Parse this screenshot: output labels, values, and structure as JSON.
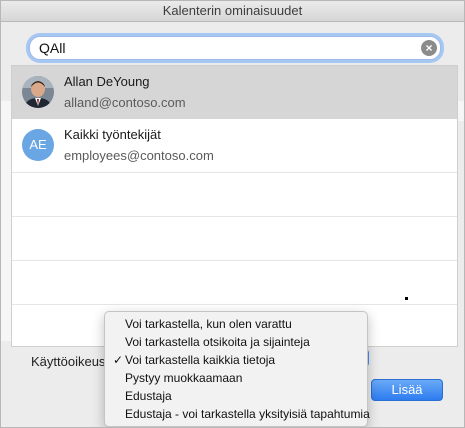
{
  "window": {
    "title": "Kalenterin ominaisuudet"
  },
  "search": {
    "value": "QAll",
    "clear_icon": "clear-icon"
  },
  "results": [
    {
      "name": "Allan DeYoung",
      "email": "alland@contoso.com",
      "avatar": "photo",
      "selected": true
    },
    {
      "name": "Kaikki työntekijät",
      "email": "employees@contoso.com",
      "initials": "AE",
      "selected": false
    }
  ],
  "permissions": {
    "label": "Käyttöoikeus"
  },
  "menu": {
    "items": [
      {
        "label": "Voi tarkastella, kun olen varattu",
        "checked": false
      },
      {
        "label": "Voi tarkastella otsikoita ja sijainteja",
        "checked": false
      },
      {
        "label": "Voi tarkastella kaikkia tietoja",
        "checked": true
      },
      {
        "label": "Pystyy muokkaamaan",
        "checked": false
      },
      {
        "label": "Edustaja",
        "checked": false
      },
      {
        "label": "Edustaja - voi tarkastella yksityisiä tapahtumia",
        "checked": false
      }
    ],
    "check_mark": "✓"
  },
  "buttons": {
    "add": "Lisää"
  },
  "colors": {
    "accent": "#2d7cf0",
    "selection": "#d6d6d6"
  }
}
